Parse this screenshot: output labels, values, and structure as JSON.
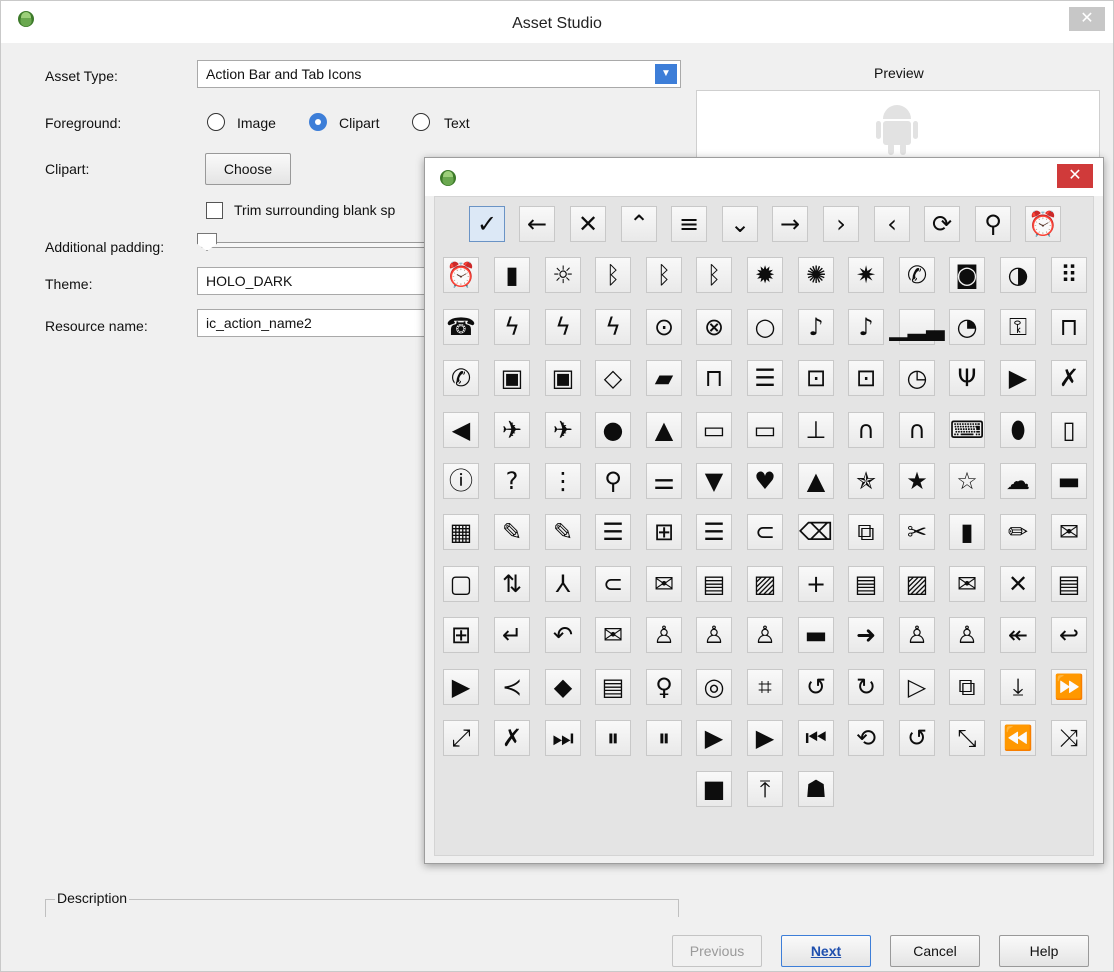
{
  "window": {
    "title": "Asset Studio",
    "close_glyph": "✕"
  },
  "form": {
    "asset_type_label": "Asset Type:",
    "asset_type_value": "Action Bar and Tab Icons",
    "foreground_label": "Foreground:",
    "radio_image": "Image",
    "radio_clipart": "Clipart",
    "radio_text": "Text",
    "clipart_label": "Clipart:",
    "choose_button": "Choose",
    "trim_checkbox": "Trim surrounding blank sp",
    "padding_label": "Additional padding:",
    "theme_label": "Theme:",
    "theme_value": "HOLO_DARK",
    "resource_label": "Resource name:",
    "resource_value": "ic_action_name2"
  },
  "preview": {
    "title": "Preview"
  },
  "description": {
    "label": "Description"
  },
  "footer": {
    "previous": "Previous",
    "next": "Next",
    "cancel": "Cancel",
    "help": "Help"
  },
  "clipart_dialog": {
    "close_glyph": "✕",
    "rows": [
      [
        {
          "name": "checkmark-icon",
          "g": "✓"
        },
        {
          "name": "arrow-left-icon",
          "g": "←"
        },
        {
          "name": "close-icon",
          "g": "✕"
        },
        {
          "name": "chevron-up-icon",
          "g": "⌃"
        },
        {
          "name": "menu-icon",
          "g": "≡"
        },
        {
          "name": "chevron-down-icon",
          "g": "⌄"
        },
        {
          "name": "arrow-right-icon",
          "g": "→"
        },
        {
          "name": "chevron-right-icon",
          "g": "›"
        },
        {
          "name": "chevron-left-icon",
          "g": "‹"
        },
        {
          "name": "refresh-icon",
          "g": "⟳"
        },
        {
          "name": "search-icon",
          "g": "⚲"
        },
        {
          "name": "add-alarm-icon",
          "g": "⏰"
        }
      ],
      [
        {
          "name": "alarm-icon",
          "g": "⏰"
        },
        {
          "name": "battery-icon",
          "g": "▮"
        },
        {
          "name": "brightness-low-icon",
          "g": "☼"
        },
        {
          "name": "bluetooth-searching-icon",
          "g": "ᛒ"
        },
        {
          "name": "bluetooth-connected-icon",
          "g": "ᛒ"
        },
        {
          "name": "bluetooth-icon",
          "g": "ᛒ"
        },
        {
          "name": "brightness-auto-icon",
          "g": "✹"
        },
        {
          "name": "brightness-high-icon",
          "g": "✺"
        },
        {
          "name": "brightness-medium-icon",
          "g": "✷"
        },
        {
          "name": "phone-icon",
          "g": "✆"
        },
        {
          "name": "camera-icon",
          "g": "◙"
        },
        {
          "name": "data-usage-icon",
          "g": "◑"
        },
        {
          "name": "dialpad-icon",
          "g": "⠿"
        }
      ],
      [
        {
          "name": "call-end-icon",
          "g": "☎"
        },
        {
          "name": "battery-charging-icon",
          "g": "ϟ"
        },
        {
          "name": "flash-off-icon",
          "g": "ϟ"
        },
        {
          "name": "flash-on-icon",
          "g": "ϟ"
        },
        {
          "name": "gps-fixed-icon",
          "g": "⊙"
        },
        {
          "name": "gps-off-icon",
          "g": "⊗"
        },
        {
          "name": "gps-not-fixed-icon",
          "g": "○"
        },
        {
          "name": "mic-off-icon",
          "g": "♪"
        },
        {
          "name": "mic-icon",
          "g": "♪"
        },
        {
          "name": "signal-icon",
          "g": "▁▂▃"
        },
        {
          "name": "wifi-icon",
          "g": "◔"
        },
        {
          "name": "vpn-key-icon",
          "g": "⚿"
        },
        {
          "name": "lock-icon",
          "g": "⊓"
        }
      ],
      [
        {
          "name": "ring-volume-icon",
          "g": "✆"
        },
        {
          "name": "screen-lock-landscape-icon",
          "g": "▣"
        },
        {
          "name": "screen-lock-portrait-icon",
          "g": "▣"
        },
        {
          "name": "screen-rotation-icon",
          "g": "◇"
        },
        {
          "name": "sd-card-icon",
          "g": "▰"
        },
        {
          "name": "secure-icon",
          "g": "⊓"
        },
        {
          "name": "storage-icon",
          "g": "☰"
        },
        {
          "name": "switch-camera-icon",
          "g": "⊡"
        },
        {
          "name": "switch-video-icon",
          "g": "⊡"
        },
        {
          "name": "time-icon",
          "g": "◷"
        },
        {
          "name": "usb-icon",
          "g": "Ψ"
        },
        {
          "name": "video-icon",
          "g": "▶"
        },
        {
          "name": "volume-muted-icon",
          "g": "✗"
        }
      ],
      [
        {
          "name": "volume-on-icon",
          "g": "◀"
        },
        {
          "name": "airplane-mode-off-icon",
          "g": "✈"
        },
        {
          "name": "airplane-mode-on-icon",
          "g": "✈"
        },
        {
          "name": "error-icon",
          "g": "●"
        },
        {
          "name": "warning-icon",
          "g": "▲"
        },
        {
          "name": "laptop-icon",
          "g": "▭"
        },
        {
          "name": "desktop-icon",
          "g": "▭"
        },
        {
          "name": "dock-icon",
          "g": "⊥"
        },
        {
          "name": "headphones-icon",
          "g": "∩"
        },
        {
          "name": "headset-icon",
          "g": "∩"
        },
        {
          "name": "keyboard-icon",
          "g": "⌨"
        },
        {
          "name": "mouse-icon",
          "g": "⬮"
        },
        {
          "name": "phone-device-icon",
          "g": "▯"
        }
      ],
      [
        {
          "name": "info-icon",
          "g": "ⓘ"
        },
        {
          "name": "help-icon",
          "g": "?"
        },
        {
          "name": "overflow-icon",
          "g": "⋮"
        },
        {
          "name": "magnify-icon",
          "g": "⚲"
        },
        {
          "name": "settings-icon",
          "g": "⚌"
        },
        {
          "name": "thumbs-down-icon",
          "g": "▼"
        },
        {
          "name": "heart-icon",
          "g": "♥"
        },
        {
          "name": "thumbs-up-icon",
          "g": "▲"
        },
        {
          "name": "star-half-icon",
          "g": "✯"
        },
        {
          "name": "star-icon",
          "g": "★"
        },
        {
          "name": "star-outline-icon",
          "g": "☆"
        },
        {
          "name": "cloud-icon",
          "g": "☁"
        },
        {
          "name": "folder-icon",
          "g": "▬"
        }
      ],
      [
        {
          "name": "calendar-icon",
          "g": "▦"
        },
        {
          "name": "edit-icon",
          "g": "✎"
        },
        {
          "name": "new-edit-icon",
          "g": "✎"
        },
        {
          "name": "sort-icon",
          "g": "☰"
        },
        {
          "name": "view-grid-icon",
          "g": "⊞"
        },
        {
          "name": "view-list-icon",
          "g": "☰"
        },
        {
          "name": "attachment-icon",
          "g": "⊂"
        },
        {
          "name": "backspace-icon",
          "g": "⌫"
        },
        {
          "name": "copy-icon",
          "g": "⧉"
        },
        {
          "name": "cut-icon",
          "g": "✂"
        },
        {
          "name": "delete-icon",
          "g": "▮"
        },
        {
          "name": "pencil-icon",
          "g": "✏"
        },
        {
          "name": "email-icon",
          "g": "✉"
        }
      ],
      [
        {
          "name": "event-icon",
          "g": "▢"
        },
        {
          "name": "import-export-icon",
          "g": "⇅"
        },
        {
          "name": "merge-icon",
          "g": "⅄"
        },
        {
          "name": "new-attachment-icon",
          "g": "⊂"
        },
        {
          "name": "new-email-icon",
          "g": "✉"
        },
        {
          "name": "new-label-icon",
          "g": "▤"
        },
        {
          "name": "new-picture-icon",
          "g": "▨"
        },
        {
          "name": "add-icon",
          "g": "+"
        },
        {
          "name": "paste-icon",
          "g": "▤"
        },
        {
          "name": "picture-icon",
          "g": "▨"
        },
        {
          "name": "read-icon",
          "g": "✉"
        },
        {
          "name": "remove-icon",
          "g": "✕"
        },
        {
          "name": "save-icon",
          "g": "▤"
        }
      ],
      [
        {
          "name": "select-all-icon",
          "g": "⊞"
        },
        {
          "name": "split-icon",
          "g": "↵"
        },
        {
          "name": "undo-icon",
          "g": "↶"
        },
        {
          "name": "unread-icon",
          "g": "✉"
        },
        {
          "name": "add-group-icon",
          "g": "♙"
        },
        {
          "name": "add-person-icon",
          "g": "♙"
        },
        {
          "name": "group-icon",
          "g": "♙"
        },
        {
          "name": "labels-icon",
          "g": "▬"
        },
        {
          "name": "forward-icon",
          "g": "➜"
        },
        {
          "name": "person-group-icon",
          "g": "♙"
        },
        {
          "name": "person-icon",
          "g": "♙"
        },
        {
          "name": "reply-all-icon",
          "g": "↞"
        },
        {
          "name": "reply-icon",
          "g": "↩"
        }
      ],
      [
        {
          "name": "send-icon",
          "g": "▶"
        },
        {
          "name": "share-icon",
          "g": "≺"
        },
        {
          "name": "directions-icon",
          "g": "◆"
        },
        {
          "name": "map-icon",
          "g": "▤"
        },
        {
          "name": "place-icon",
          "g": "♀"
        },
        {
          "name": "web-site-icon",
          "g": "◎"
        },
        {
          "name": "crop-icon",
          "g": "⌗"
        },
        {
          "name": "rotate-left-icon",
          "g": "↺"
        },
        {
          "name": "rotate-right-icon",
          "g": "↻"
        },
        {
          "name": "slideshow-icon",
          "g": "▷"
        },
        {
          "name": "new-window-icon",
          "g": "⧉"
        },
        {
          "name": "download-icon",
          "g": "⤓"
        },
        {
          "name": "fast-forward-icon",
          "g": "⏩"
        }
      ],
      [
        {
          "name": "full-screen-icon",
          "g": "⤢"
        },
        {
          "name": "pin-icon",
          "g": "✗"
        },
        {
          "name": "next-icon",
          "g": "⏭"
        },
        {
          "name": "pause-over-video-icon",
          "g": "⏸"
        },
        {
          "name": "pause-icon",
          "g": "⏸"
        },
        {
          "name": "play-over-video-icon",
          "g": "▶"
        },
        {
          "name": "play-icon",
          "g": "▶"
        },
        {
          "name": "previous-icon",
          "g": "⏮"
        },
        {
          "name": "repeat-icon",
          "g": "⟲"
        },
        {
          "name": "replay-icon",
          "g": "↺"
        },
        {
          "name": "return-from-full-screen-icon",
          "g": "⤡"
        },
        {
          "name": "rewind-icon",
          "g": "⏪"
        },
        {
          "name": "shuffle-icon",
          "g": "⤨"
        }
      ],
      [
        {
          "name": "stop-icon",
          "g": "■"
        },
        {
          "name": "upload-icon",
          "g": "⤒"
        },
        {
          "name": "android-icon",
          "g": "☗"
        }
      ]
    ]
  },
  "colors": {
    "accent": "#3d7ed8",
    "close_red": "#d03a3a"
  }
}
